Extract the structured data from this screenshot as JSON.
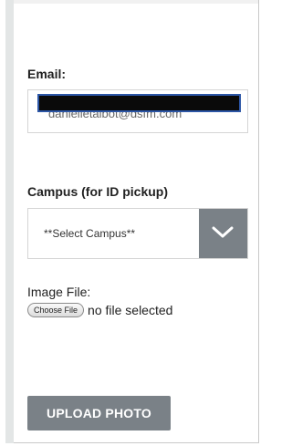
{
  "form": {
    "email": {
      "label": "Email:",
      "value": "danielletalbot@dsfm.com"
    },
    "campus": {
      "label": "Campus (for ID pickup)",
      "selected": "**Select Campus**"
    },
    "image_file": {
      "label": "Image File:",
      "choose_button": "Choose File",
      "status": "no file selected"
    },
    "upload_button": "UPLOAD PHOTO"
  },
  "colors": {
    "button_gray": "#7a8187",
    "redaction_border": "#2c56a6"
  },
  "icons": {
    "select_arrow": "chevron-down-icon"
  }
}
